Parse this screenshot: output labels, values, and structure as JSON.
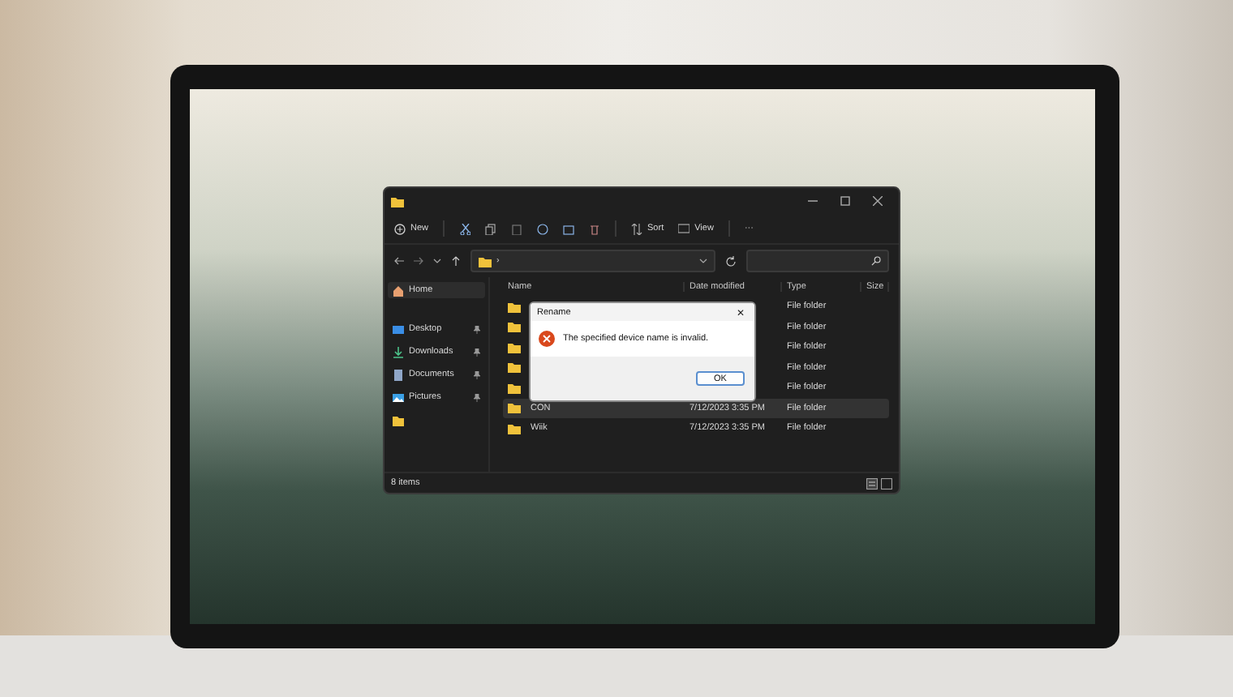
{
  "toolbar": {
    "new": "New",
    "sort": "Sort",
    "view": "View",
    "more": "···"
  },
  "address": {
    "separator": "›"
  },
  "sidebar": {
    "items": [
      {
        "kind": "home",
        "label": "Home",
        "selected": true,
        "pinned": false
      },
      {
        "kind": "desktop",
        "label": "Desktop",
        "selected": false,
        "pinned": true
      },
      {
        "kind": "downloads",
        "label": "Downloads",
        "selected": false,
        "pinned": true
      },
      {
        "kind": "documents",
        "label": "Documents",
        "selected": false,
        "pinned": true
      },
      {
        "kind": "pictures",
        "label": "Pictures",
        "selected": false,
        "pinned": true
      },
      {
        "kind": "folder",
        "selected": false,
        "pinned": false
      }
    ]
  },
  "table": {
    "columns": [
      "Name",
      "Date modified",
      "Type",
      "Size"
    ],
    "rows": [
      {
        "type": "File folder",
        "selected": false
      },
      {
        "type": "File folder",
        "selected": false
      },
      {
        "type": "File folder",
        "selected": false
      },
      {
        "type": "File folder",
        "selected": false
      },
      {
        "type": "File folder",
        "selected": false
      },
      {
        "name": "CON",
        "date": "7/12/2023 3:35 PM",
        "type": "File folder",
        "selected": true
      },
      {
        "name": "Wiik",
        "date": "7/12/2023 3:35 PM",
        "type": "File folder",
        "selected": false
      }
    ]
  },
  "status_bar": {
    "count": "8 items"
  },
  "dialog": {
    "title": "Rename",
    "close": "✕",
    "message": "The specified device name is invalid.",
    "button": "OK"
  }
}
